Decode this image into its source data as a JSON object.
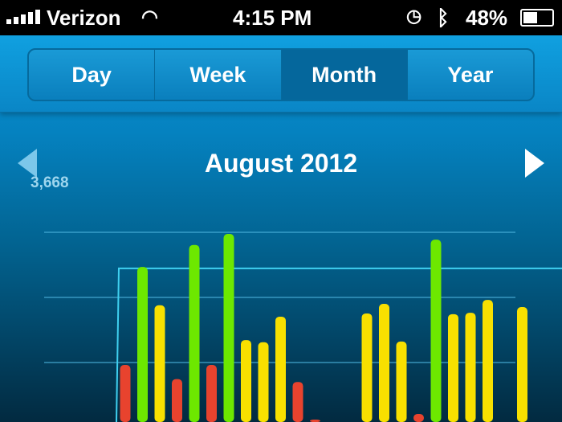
{
  "status": {
    "carrier": "Verizon",
    "time": "4:15 PM",
    "battery": "48%",
    "icons": [
      "signal-icon",
      "wifi-icon",
      "alarm-icon",
      "bluetooth-icon",
      "battery-icon"
    ]
  },
  "tabs": [
    {
      "label": "Day"
    },
    {
      "label": "Week"
    },
    {
      "label": "Month",
      "active": true
    },
    {
      "label": "Year"
    }
  ],
  "nav": {
    "title": "August 2012"
  },
  "chart_data": {
    "type": "bar",
    "y_max_label": "3,668",
    "ylim": [
      0,
      3668
    ],
    "grid": true,
    "goal": 3160,
    "values": [
      1800,
      3180,
      2640,
      1600,
      3490,
      1800,
      3645,
      2150,
      2120,
      2480,
      1560,
      1030,
      null,
      null,
      2525,
      2660,
      2130,
      1110,
      3565,
      2515,
      2535,
      2715,
      null,
      2615
    ],
    "colors": {
      "low": "#e8432e",
      "mid": "#f8e000",
      "high": "#6de800"
    }
  }
}
